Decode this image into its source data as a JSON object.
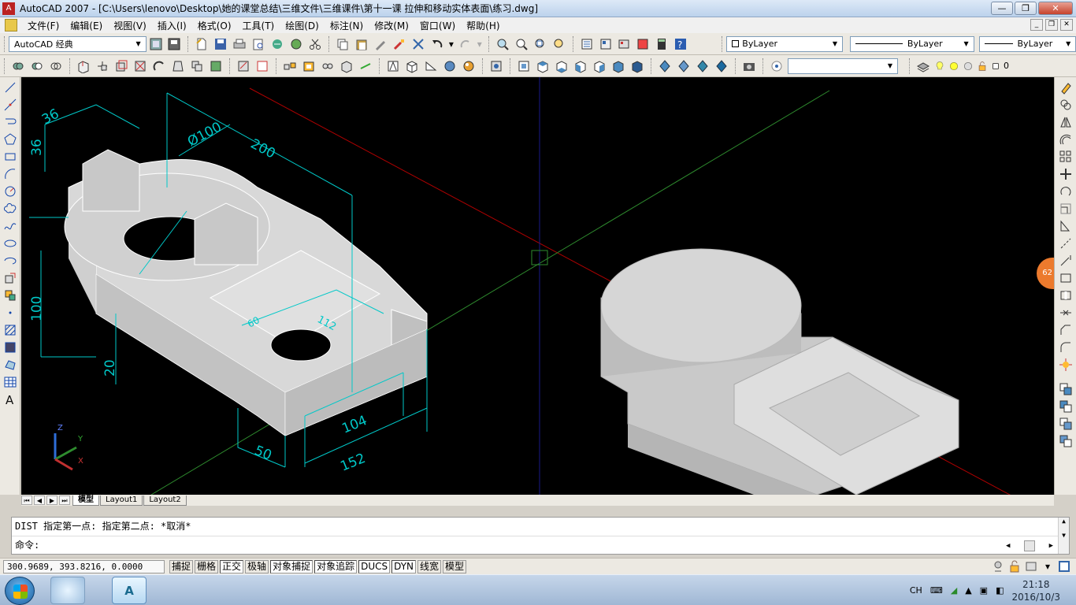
{
  "window": {
    "title": "AutoCAD 2007 - [C:\\Users\\lenovo\\Desktop\\她的课堂总结\\三维文件\\三维课件\\第十一课 拉伸和移动实体表面\\练习.dwg]",
    "buttons": [
      "minimize",
      "maximize",
      "close"
    ]
  },
  "menu": [
    "文件(F)",
    "编辑(E)",
    "视图(V)",
    "插入(I)",
    "格式(O)",
    "工具(T)",
    "绘图(D)",
    "标注(N)",
    "修改(M)",
    "窗口(W)",
    "帮助(H)"
  ],
  "toolbar": {
    "workspace": "AutoCAD 经典",
    "color_combo": "ByLayer",
    "linetype_combo": "ByLayer",
    "lineweight_combo": "ByLayer",
    "layer_combo": "0"
  },
  "drawing": {
    "dimensions": [
      "36",
      "36",
      "Ø100",
      "200",
      "100",
      "20",
      "104",
      "152",
      "50",
      "112",
      "60"
    ],
    "ucs_labels": [
      "Z",
      "Y",
      "X"
    ],
    "badge": "62"
  },
  "layout_tabs": [
    "模型",
    "Layout1",
    "Layout2"
  ],
  "command": {
    "history": "DIST 指定第一点:  指定第二点: *取消*",
    "prompt": "命令:"
  },
  "status": {
    "coords": "300.9689, 393.8216, 0.0000",
    "buttons": [
      "捕捉",
      "栅格",
      "正交",
      "极轴",
      "对象捕捉",
      "对象追踪",
      "DUCS",
      "DYN",
      "线宽",
      "模型"
    ]
  },
  "taskbar": {
    "lang": "CH",
    "time": "21:18",
    "date": "2016/10/3"
  },
  "colors": {
    "accent": "#00c8c8",
    "axis_red": "#b00000",
    "axis_green": "#2e8b2e",
    "axis_blue": "#1a1a8a"
  }
}
